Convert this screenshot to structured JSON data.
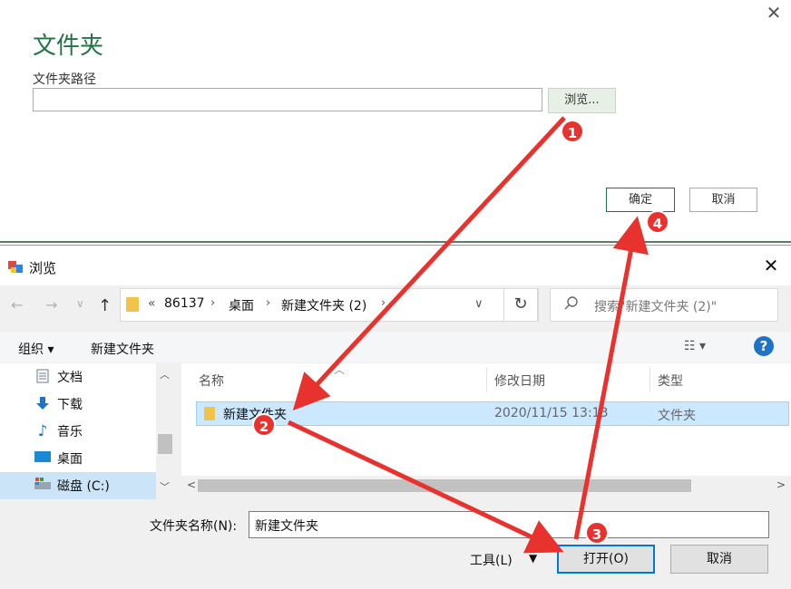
{
  "top_dialog": {
    "title": "文件夹",
    "path_label": "文件夹路径",
    "path_value": "",
    "browse_label": "浏览...",
    "ok_label": "确定",
    "cancel_label": "取消",
    "close_glyph": "✕"
  },
  "browse_dialog": {
    "title": "浏览",
    "close_glyph": "✕",
    "nav": {
      "back": "←",
      "forward": "→",
      "dropdown": "∨",
      "up": "↑"
    },
    "address": {
      "overflow": "«",
      "crumbs": [
        "86137",
        "桌面",
        "新建文件夹 (2)"
      ],
      "separator": "›",
      "dropdown": "∨"
    },
    "refresh_glyph": "↻",
    "search_placeholder": "搜索\"新建文件夹 (2)\"",
    "toolbar": {
      "organize": "组织 ▾",
      "new_folder": "新建文件夹",
      "view": "☷ ▾",
      "help": "?"
    },
    "nav_pane": [
      {
        "label": "文档",
        "icon": "document-icon"
      },
      {
        "label": "下载",
        "icon": "download-icon"
      },
      {
        "label": "音乐",
        "icon": "music-icon"
      },
      {
        "label": "桌面",
        "icon": "desktop-icon"
      },
      {
        "label": "磁盘 (C:)",
        "icon": "drive-icon",
        "selected": true
      }
    ],
    "columns": {
      "name": "名称",
      "modified": "修改日期",
      "type": "类型"
    },
    "files": [
      {
        "name": "新建文件夹",
        "modified": "2020/11/15 13:13",
        "type": "文件夹",
        "selected": true
      }
    ],
    "folder_name_label": "文件夹名称(N):",
    "folder_name_value": "新建文件夹",
    "tools_label": "工具(L)",
    "open_label": "打开(O)",
    "cancel_label": "取消"
  },
  "annotations": {
    "steps": [
      "1",
      "2",
      "3",
      "4"
    ],
    "color": "#e8322e"
  },
  "colors": {
    "excel_green": "#217346",
    "selection_blue": "#cce8ff",
    "accent_blue": "#0078d7"
  }
}
